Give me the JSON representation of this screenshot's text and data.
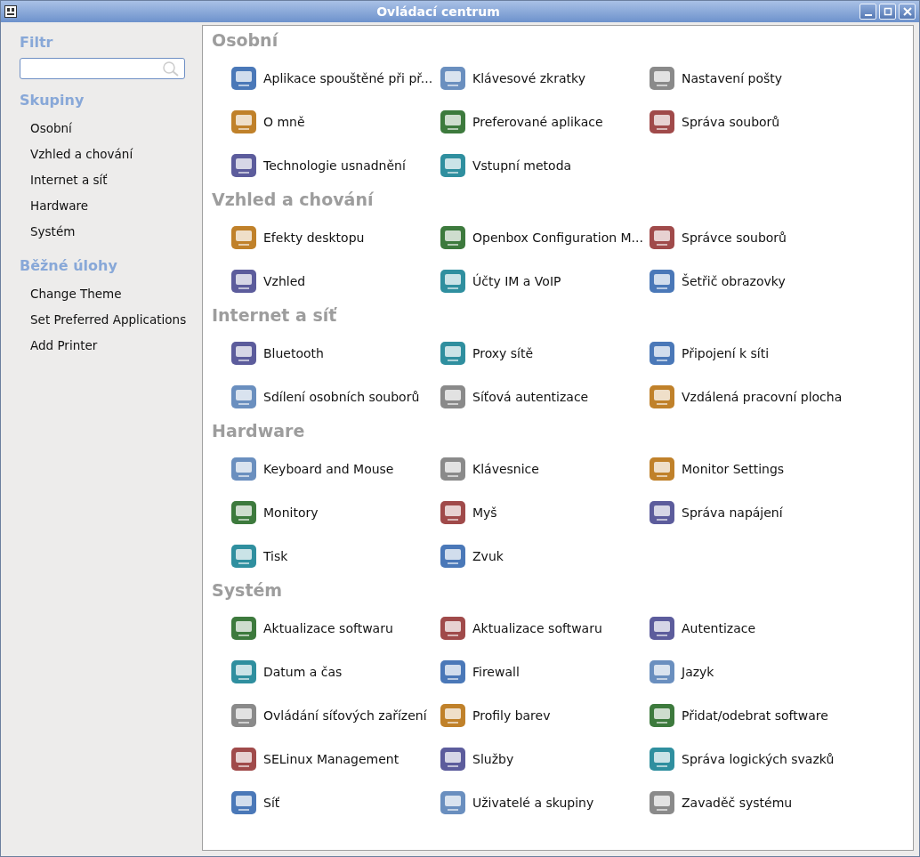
{
  "window": {
    "title": "Ovládací centrum"
  },
  "sidebar": {
    "filter_heading": "Filtr",
    "groups_heading": "Skupiny",
    "groups": [
      "Osobní",
      "Vzhled a chování",
      "Internet a síť",
      "Hardware",
      "Systém"
    ],
    "tasks_heading": "Běžné úlohy",
    "tasks": [
      "Change Theme",
      "Set Preferred Applications",
      "Add Printer"
    ]
  },
  "sections": [
    {
      "title": "Osobní",
      "items": [
        "Aplikace spouštěné při př...",
        "Klávesové zkratky",
        "Nastavení pošty",
        "O mně",
        "Preferované aplikace",
        "Správa souborů",
        "Technologie usnadnění",
        "Vstupní metoda"
      ]
    },
    {
      "title": "Vzhled a chování",
      "items": [
        "Efekty desktopu",
        "Openbox Configuration M...",
        "Správce souborů",
        "Vzhled",
        "Účty IM a VoIP",
        "Šetřič obrazovky"
      ]
    },
    {
      "title": "Internet a síť",
      "items": [
        "Bluetooth",
        "Proxy sítě",
        "Připojení k síti",
        "Sdílení osobních souborů",
        "Síťová autentizace",
        "Vzdálená pracovní plocha"
      ]
    },
    {
      "title": "Hardware",
      "items": [
        "Keyboard and Mouse",
        "Klávesnice",
        "Monitor Settings",
        "Monitory",
        "Myš",
        "Správa napájení",
        "Tisk",
        "Zvuk"
      ]
    },
    {
      "title": "Systém",
      "items": [
        "Aktualizace softwaru",
        "Aktualizace softwaru",
        "Autentizace",
        "Datum a čas",
        "Firewall",
        "Jazyk",
        "Ovládání síťových zařízení",
        "Profily barev",
        "Přidat/odebrat software",
        "SELinux Management",
        "Služby",
        "Správa logických svazků",
        "Síť",
        "Uživatelé a skupiny",
        "Zavaděč systému"
      ]
    }
  ]
}
